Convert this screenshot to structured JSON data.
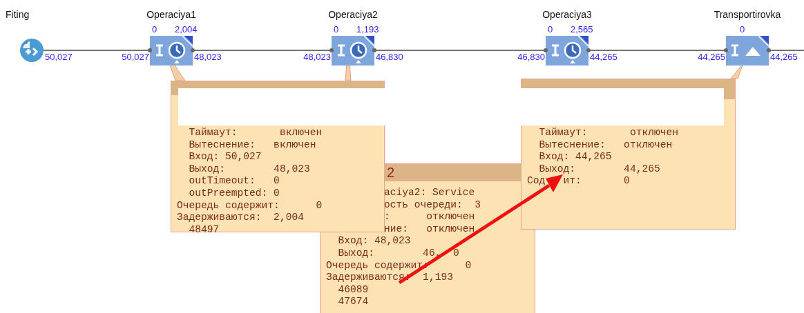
{
  "blocks": [
    {
      "name": "Fiting",
      "kind": "source",
      "out": "50,027"
    },
    {
      "name": "Operaciya1",
      "kind": "service",
      "in": "50,027",
      "out": "48,023",
      "queue": "0",
      "delay": "2,004"
    },
    {
      "name": "Operaciya2",
      "kind": "service",
      "in": "48,023",
      "out": "46,830",
      "queue": "0",
      "delay": "1,193"
    },
    {
      "name": "Operaciya3",
      "kind": "service",
      "in": "46,830",
      "out": "44,265",
      "queue": "0",
      "delay": "2,565"
    },
    {
      "name": "Transportirovka",
      "kind": "conveyor",
      "in": "44,265",
      "out": "44,265",
      "queue": "0"
    }
  ],
  "inspectors": [
    {
      "lines": [
        {
          "text": "  Таймаут:       включен",
          "kind": "plain"
        },
        {
          "text": "  Вытеснение:   включен",
          "kind": "plain"
        },
        {
          "text": "  Вход: 50,027",
          "kind": "plain"
        },
        {
          "text": "  Выход:        48,023",
          "kind": "plain"
        },
        {
          "text": "  outTimeout:   0",
          "kind": "plain"
        },
        {
          "text": "  outPreempted: 0",
          "kind": "plain"
        },
        {
          "text": "Очередь содержит:      0",
          "kind": "plain"
        },
        {
          "text": "Задерживаются:  2,004",
          "kind": "plain"
        },
        {
          "text": "  48497",
          "kind": "plain"
        }
      ]
    },
    {
      "title": "2",
      "lines": [
        {
          "text": "aciya2: Service",
          "kind": "covered"
        },
        {
          "text": "ость очереди:  3",
          "kind": "covered"
        },
        {
          "text": ":      отключен",
          "kind": "covered"
        },
        {
          "text": "ние:   отключен",
          "kind": "covered"
        },
        {
          "text": "  Вход: 48,023",
          "kind": "plain"
        },
        {
          "text": "  Выход:        46,  0",
          "kind": "plain"
        },
        {
          "text": "Очередь содержит:      0",
          "kind": "plain"
        },
        {
          "text": "Задерживаются:  1,193",
          "kind": "plain"
        },
        {
          "text": "  46089",
          "kind": "plain"
        },
        {
          "text": "  47674",
          "kind": "plain"
        }
      ]
    },
    {
      "lines": [
        {
          "text": "  Таймаут:       отключен",
          "kind": "plain"
        },
        {
          "text": "  Вытеснение:   отключен",
          "kind": "plain"
        },
        {
          "text": "  Вход: 44,265",
          "kind": "plain"
        },
        {
          "text": "  Выход:        44,265",
          "kind": "plain"
        },
        {
          "text": "Сод   ит:       0",
          "kind": "plain"
        }
      ]
    }
  ]
}
